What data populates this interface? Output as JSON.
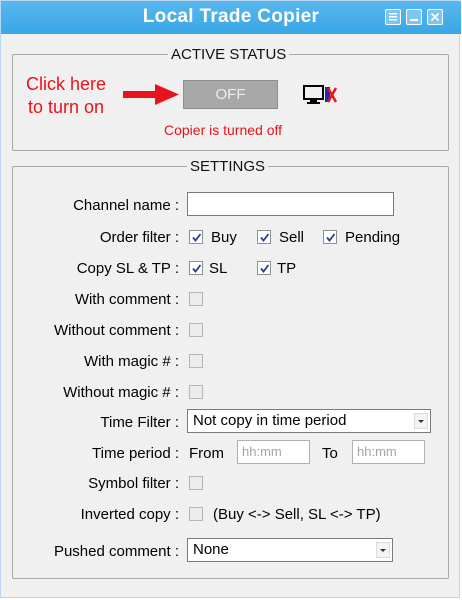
{
  "window": {
    "title": "Local Trade Copier",
    "title_icons": [
      "list-icon",
      "minimize-icon",
      "close-icon"
    ]
  },
  "active_status": {
    "legend": "ACTIVE STATUS",
    "hint_line1": "Click here",
    "hint_line2": "to turn on",
    "toggle_label": "OFF",
    "status_message": "Copier is turned off",
    "status_icon": "monitor-disconnected-icon"
  },
  "settings": {
    "legend": "SETTINGS",
    "channel_name": {
      "label": "Channel name :",
      "value": ""
    },
    "order_filter": {
      "label": "Order filter :",
      "options": [
        {
          "label": "Buy",
          "checked": true
        },
        {
          "label": "Sell",
          "checked": true
        },
        {
          "label": "Pending",
          "checked": true
        }
      ]
    },
    "copy_sl_tp": {
      "label": "Copy SL & TP :",
      "options": [
        {
          "label": "SL",
          "checked": true
        },
        {
          "label": "TP",
          "checked": true
        }
      ]
    },
    "with_comment": {
      "label": "With comment :",
      "checked": false
    },
    "without_comment": {
      "label": "Without comment :",
      "checked": false
    },
    "with_magic": {
      "label": "With magic # :",
      "checked": false
    },
    "without_magic": {
      "label": "Without magic # :",
      "checked": false
    },
    "time_filter": {
      "label": "Time Filter :",
      "value": "Not copy in time period"
    },
    "time_period": {
      "label": "Time period :",
      "from_label": "From",
      "from_placeholder": "hh:mm",
      "to_label": "To",
      "to_placeholder": "hh:mm"
    },
    "symbol_filter": {
      "label": "Symbol filter :",
      "checked": false
    },
    "inverted_copy": {
      "label": "Inverted copy :",
      "checked": false,
      "note": "(Buy <-> Sell, SL <-> TP)"
    },
    "pushed_comment": {
      "label": "Pushed comment :",
      "value": "None"
    }
  },
  "colors": {
    "titlebar": "#3aa6e6",
    "hint_red": "#e8141b",
    "panel_bg": "#f0f0f0"
  }
}
